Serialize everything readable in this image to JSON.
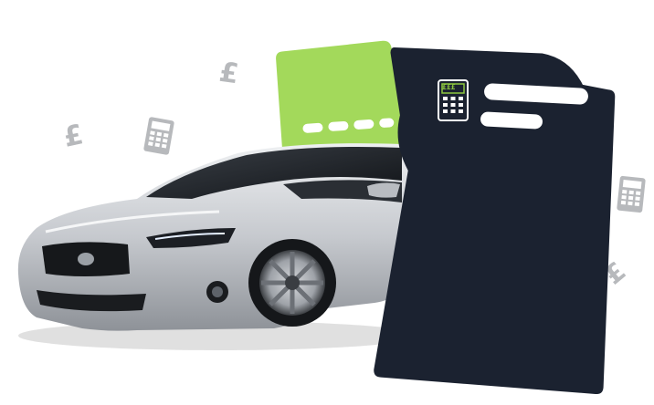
{
  "illustration": {
    "pound_symbol": "£",
    "calculator_display": "£££",
    "icons": [
      "pound-icon",
      "calculator-icon",
      "car-image",
      "document-card-icon"
    ],
    "colors": {
      "green_card": "#a3d95b",
      "dark_card": "#1b2230",
      "icon_grey": "#b7b9bc",
      "white_bar": "#ffffff",
      "car_body": "#c8cbd0"
    }
  }
}
